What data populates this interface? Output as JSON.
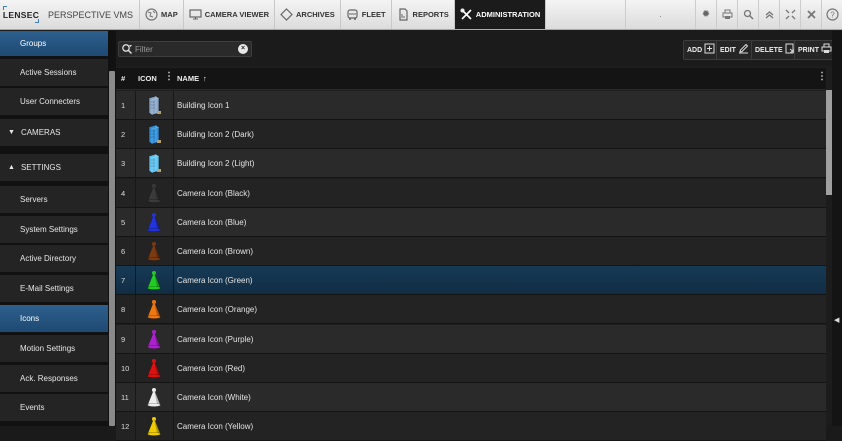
{
  "topbar": {
    "logo": "LENSEC",
    "product": "PERSPECTIVE VMS",
    "nav": [
      {
        "label": "MAP",
        "icon": "globe-icon"
      },
      {
        "label": "CAMERA VIEWER",
        "icon": "monitor-icon"
      },
      {
        "label": "ARCHIVES",
        "icon": "diamond-icon"
      },
      {
        "label": "FLEET",
        "icon": "vehicle-icon"
      },
      {
        "label": "REPORTS",
        "icon": "document-icon"
      },
      {
        "label": "ADMINISTRATION",
        "icon": "tools-icon",
        "active": true
      }
    ],
    "info": ".",
    "right_icons": [
      "gear-icon",
      "print-icon",
      "search-icon",
      "double-chevron-up-icon",
      "collapse-icon",
      "close-icon",
      "help-icon"
    ]
  },
  "sidebar": {
    "items": [
      {
        "label": "Groups",
        "type": "item",
        "selected": true
      },
      {
        "label": "Active Sessions",
        "type": "item"
      },
      {
        "label": "User Connecters",
        "type": "item"
      },
      {
        "label": "CAMERAS",
        "type": "section",
        "expanded": false
      },
      {
        "label": "SETTINGS",
        "type": "section",
        "expanded": true
      },
      {
        "label": "Servers",
        "type": "item"
      },
      {
        "label": "System Settings",
        "type": "item"
      },
      {
        "label": "Active Directory",
        "type": "item"
      },
      {
        "label": "E-Mail Settings",
        "type": "item"
      },
      {
        "label": "Icons",
        "type": "item",
        "selected": true
      },
      {
        "label": "Motion Settings",
        "type": "item"
      },
      {
        "label": "Ack. Responses",
        "type": "item"
      },
      {
        "label": "Events",
        "type": "item"
      }
    ]
  },
  "toolbar": {
    "filter_placeholder": "Filter",
    "buttons": [
      {
        "label": "ADD",
        "icon": "add-icon"
      },
      {
        "label": "EDIT",
        "icon": "pencil-icon"
      },
      {
        "label": "DELETE",
        "icon": "delete-icon"
      },
      {
        "label": "PRINT",
        "icon": "print-icon"
      }
    ]
  },
  "table": {
    "columns": {
      "num": "#",
      "icon": "ICON",
      "name": "NAME",
      "sort": "↑"
    },
    "rows": [
      {
        "num": "1",
        "name": "Building Icon 1",
        "icon": "building-icon",
        "color": "#8aa7c9"
      },
      {
        "num": "2",
        "name": "Building Icon 2 (Dark)",
        "icon": "building-icon",
        "color": "#2f8fd8"
      },
      {
        "num": "3",
        "name": "Building Icon 2 (Light)",
        "icon": "building-icon",
        "color": "#5ec2f0"
      },
      {
        "num": "4",
        "name": "Camera Icon (Black)",
        "icon": "camera-pin-icon",
        "color": "#3a3a3a"
      },
      {
        "num": "5",
        "name": "Camera Icon (Blue)",
        "icon": "camera-pin-icon",
        "color": "#2233dd"
      },
      {
        "num": "6",
        "name": "Camera Icon (Brown)",
        "icon": "camera-pin-icon",
        "color": "#7a3a12"
      },
      {
        "num": "7",
        "name": "Camera Icon (Green)",
        "icon": "camera-pin-icon",
        "color": "#22cc22",
        "selected": true
      },
      {
        "num": "8",
        "name": "Camera Icon (Orange)",
        "icon": "camera-pin-icon",
        "color": "#ee7711"
      },
      {
        "num": "9",
        "name": "Camera Icon (Purple)",
        "icon": "camera-pin-icon",
        "color": "#aa22cc"
      },
      {
        "num": "10",
        "name": "Camera Icon (Red)",
        "icon": "camera-pin-icon",
        "color": "#dd1111"
      },
      {
        "num": "11",
        "name": "Camera Icon (White)",
        "icon": "camera-pin-icon",
        "color": "#eeeeee"
      },
      {
        "num": "12",
        "name": "Camera Icon (Yellow)",
        "icon": "camera-pin-icon",
        "color": "#eecc00"
      }
    ]
  },
  "colors": {
    "accent": "#2d5f8e",
    "selected_row": "#173a55",
    "topbar_bg": "#e8e8e8"
  }
}
